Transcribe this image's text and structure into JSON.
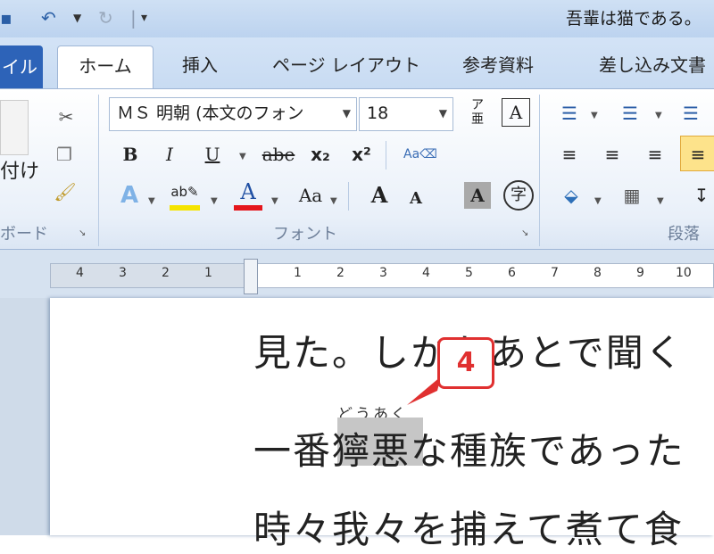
{
  "quick_access": {
    "save_icon": "save-icon",
    "undo_icon": "undo-icon",
    "redo_icon": "redo-icon"
  },
  "window": {
    "title": "吾輩は猫である。"
  },
  "tabs": {
    "file": "イル",
    "home": "ホーム",
    "insert": "挿入",
    "page_layout": "ページ レイアウト",
    "references": "参考資料",
    "mailings": "差し込み文書"
  },
  "ribbon": {
    "clipboard": {
      "paste_label": "付け",
      "group_label": "ボード"
    },
    "font": {
      "name": "ＭＳ 明朝 (本文のフォン",
      "size": "18",
      "group_label": "フォント",
      "bold": "B",
      "italic": "I",
      "underline": "U",
      "strike": "abe",
      "subscript": "x₂",
      "superscript": "x²",
      "grow": "A",
      "shrink": "A",
      "clear_char": "A",
      "enclose": "字",
      "case": "Aa"
    },
    "paragraph": {
      "group_label": "段落"
    }
  },
  "ruler": {
    "left_marks": [
      "4",
      "3",
      "2",
      "1"
    ],
    "right_marks": [
      "1",
      "2",
      "3",
      "4",
      "5",
      "6",
      "7",
      "8",
      "9",
      "10"
    ]
  },
  "document": {
    "line1": "見た。しかもあとで聞く",
    "line2_prefix": "一番",
    "line2_selected": "獰悪",
    "line2_suffix": "な種族であった",
    "ruby": "どうあく",
    "line3": "時々我々を捕えて煮て食"
  },
  "callout": {
    "number": "4"
  }
}
